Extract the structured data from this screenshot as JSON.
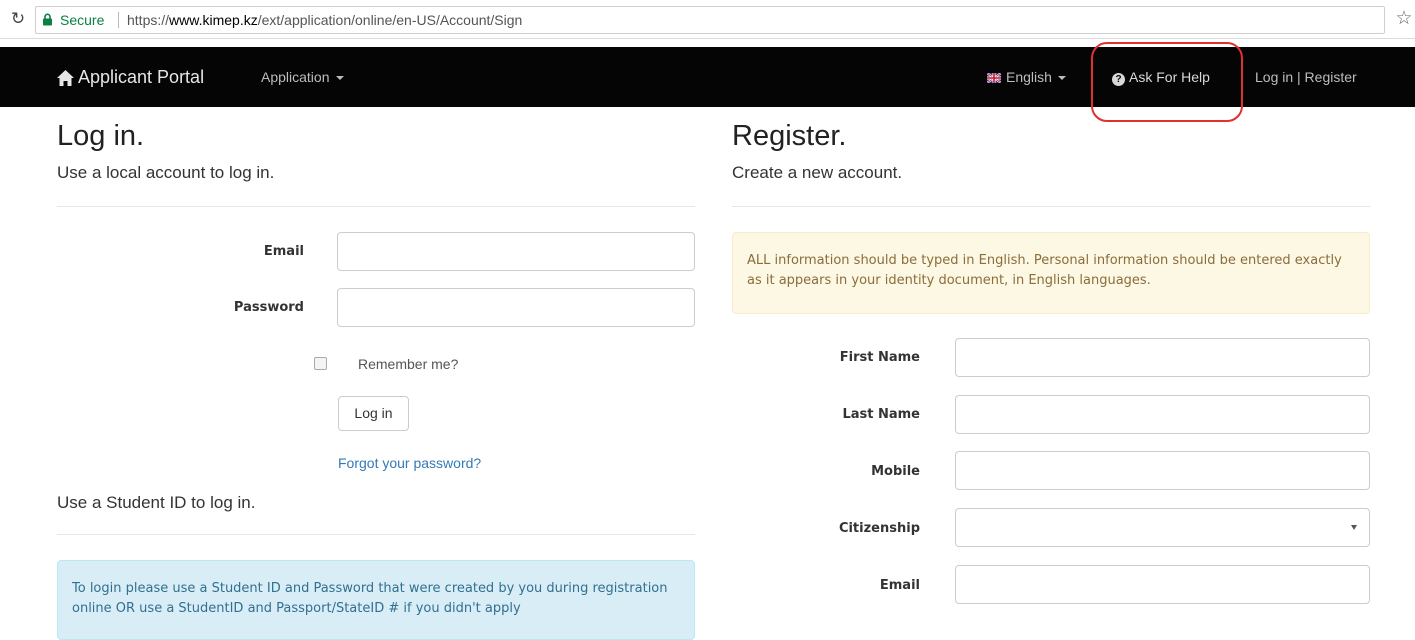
{
  "browser": {
    "secure_label": "Secure",
    "url_scheme": "https://",
    "url_host": "www.kimep.kz",
    "url_path": "/ext/application/online/en-US/Account/Sign"
  },
  "navbar": {
    "brand": "Applicant Portal",
    "application_menu": "Application",
    "language": "English",
    "help": "Ask For Help",
    "login_register": "Log in | Register"
  },
  "login": {
    "title": "Log in.",
    "subtitle": "Use a local account to log in.",
    "email_label": "Email",
    "email_value": "",
    "password_label": "Password",
    "password_value": "",
    "remember_label": "Remember me?",
    "remember_checked": false,
    "button_label": "Log in",
    "forgot_link": "Forgot your password?",
    "student_id_heading": "Use a Student ID to log in.",
    "student_id_info": "To login please use a Student ID and Password that were created by you during registration online OR use a StudentID and Passport/StateID # if you didn't apply"
  },
  "register": {
    "title": "Register.",
    "subtitle": "Create a new account.",
    "notice": "ALL information should be typed in English. Personal information should be entered exactly as it appears in your identity document, in English languages.",
    "first_name_label": "First Name",
    "first_name_value": "",
    "last_name_label": "Last Name",
    "last_name_value": "",
    "mobile_label": "Mobile",
    "mobile_value": "",
    "citizenship_label": "Citizenship",
    "citizenship_value": "",
    "email_label": "Email",
    "email_value": ""
  },
  "colors": {
    "navbar_bg": "#050505",
    "link": "#337ab7",
    "warning_bg": "#fcf8e3",
    "info_bg": "#d9edf7",
    "highlight": "#e0302f"
  },
  "icons": [
    "reload-icon",
    "lock-icon",
    "star-icon",
    "home-icon",
    "uk-flag-icon",
    "question-circle-icon"
  ]
}
